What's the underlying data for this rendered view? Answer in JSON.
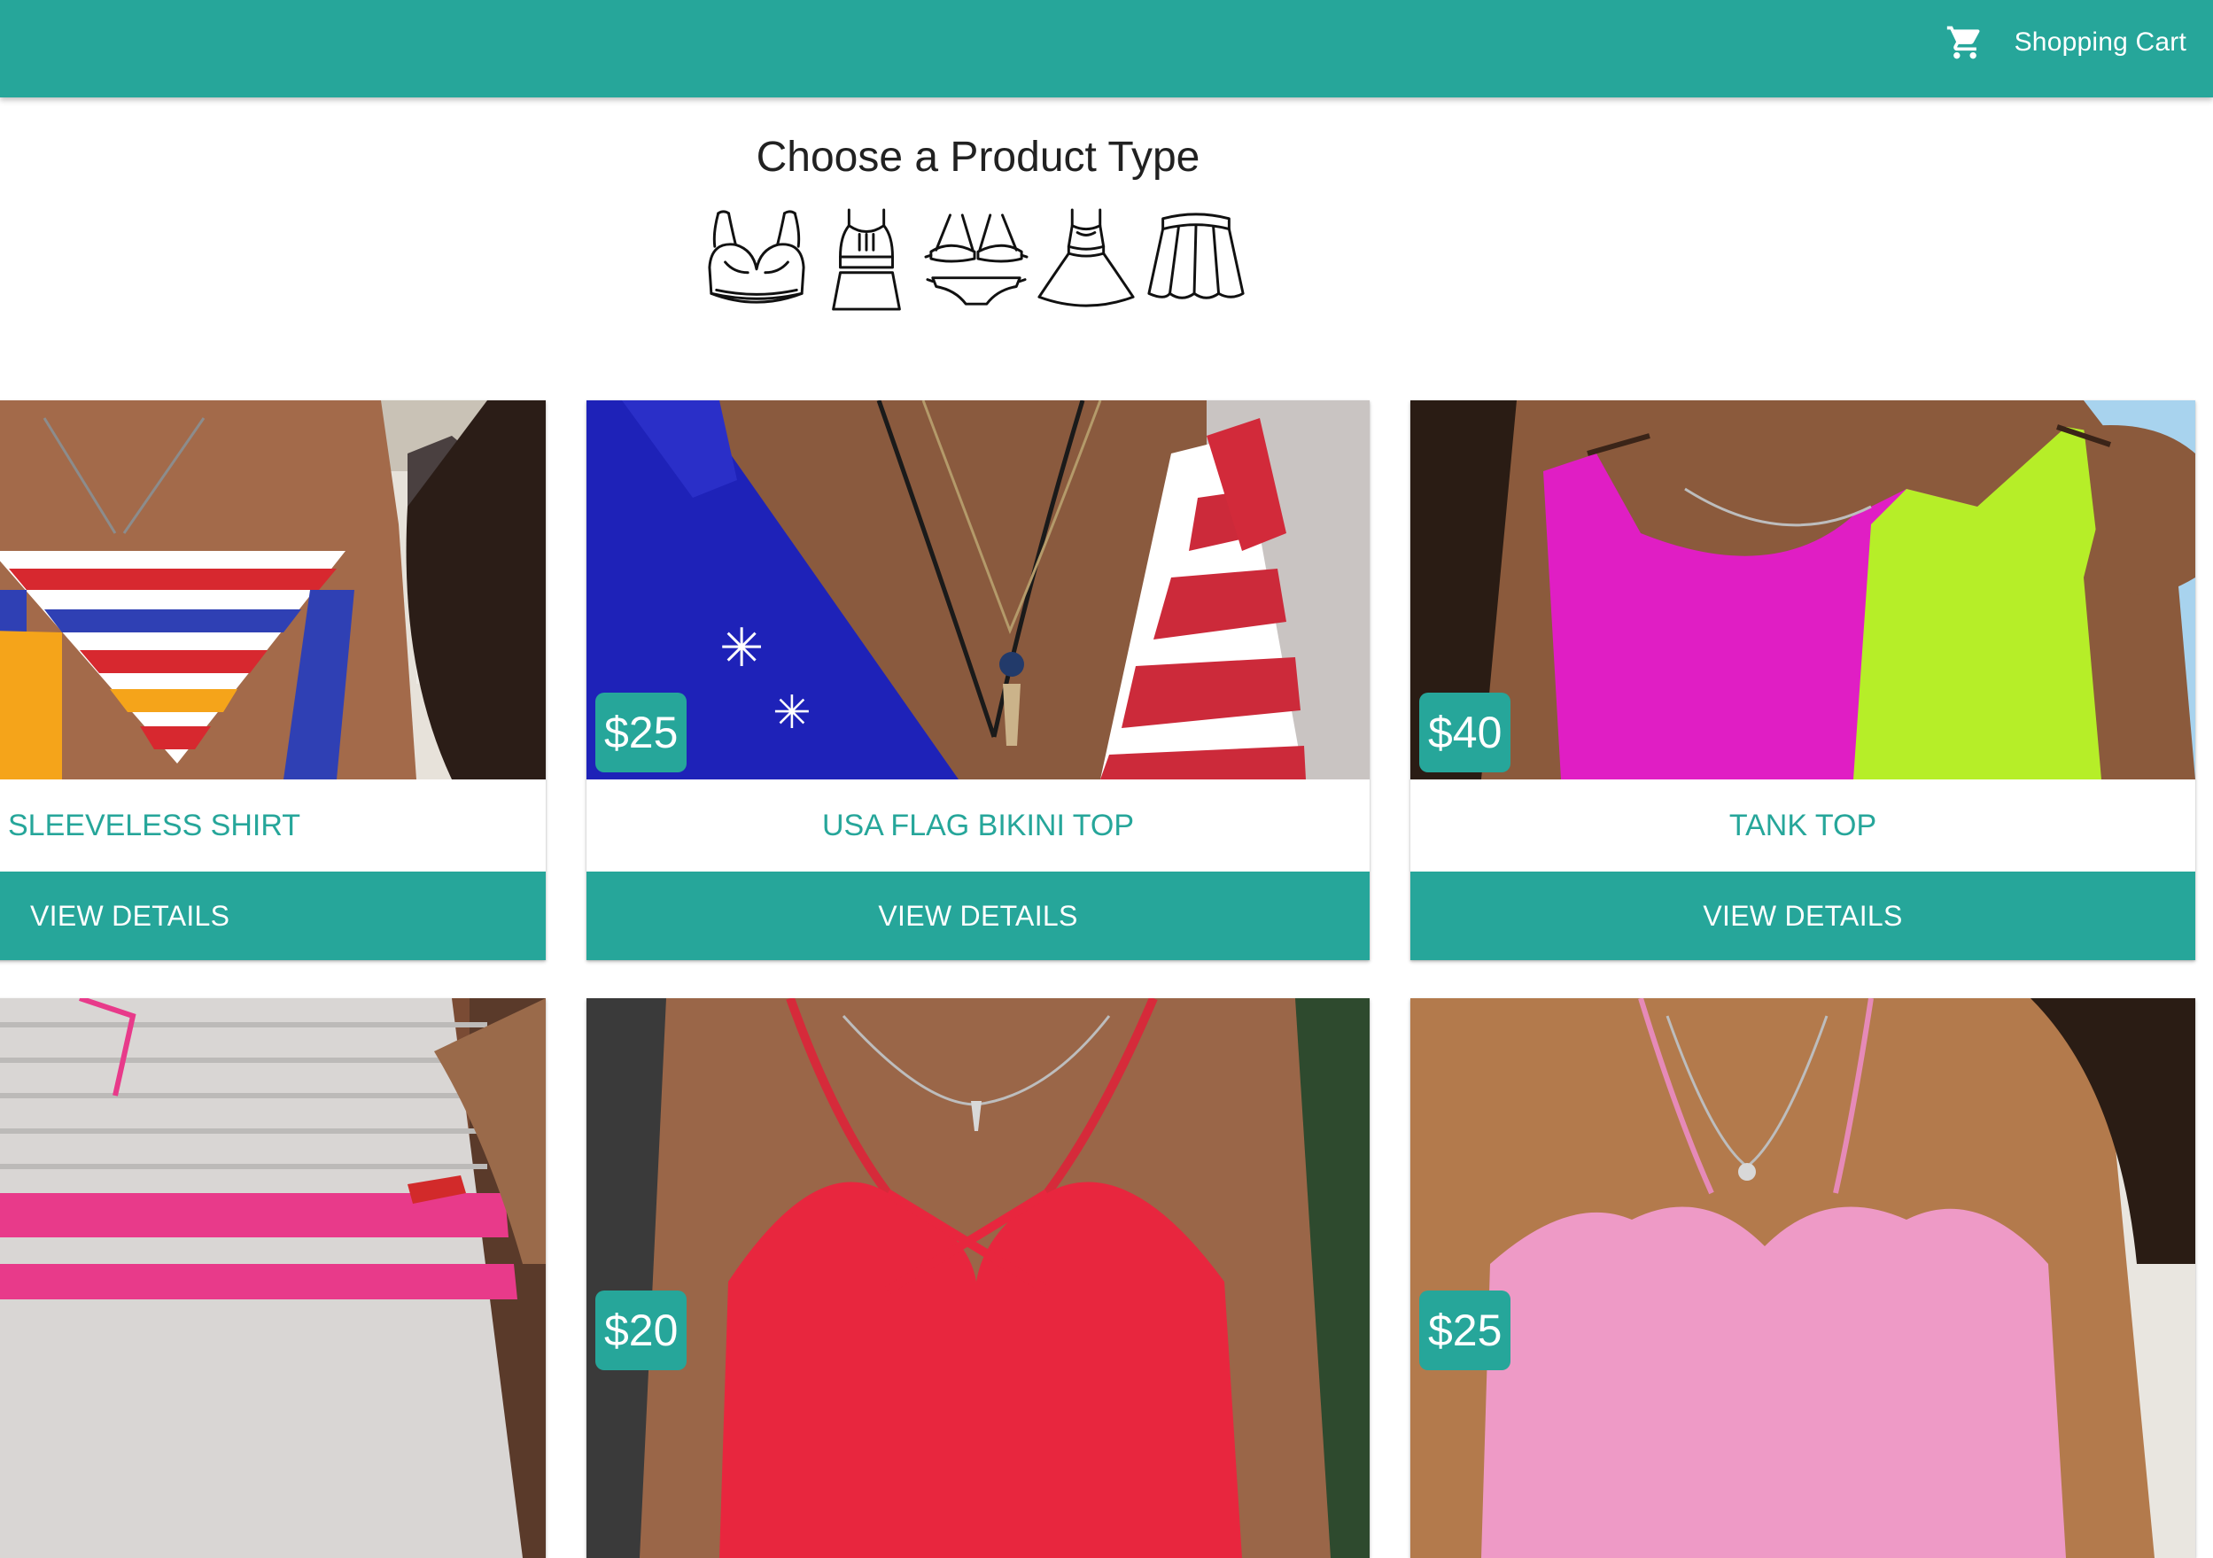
{
  "header": {
    "cart_icon": "shopping-cart-icon",
    "cart_label": "Shopping Cart",
    "accent_color": "#26a69a"
  },
  "product_types": {
    "title": "Choose a Product Type",
    "icons": [
      "bra-icon",
      "crop-top-and-skirt-icon",
      "bikini-icon",
      "dress-icon",
      "skirt-icon"
    ]
  },
  "products": [
    {
      "name": "SLEEVELESS SHIRT",
      "price": "",
      "button": "VIEW DETAILS"
    },
    {
      "name": "USA FLAG BIKINI TOP",
      "price": "$25",
      "button": "VIEW DETAILS"
    },
    {
      "name": "TANK TOP",
      "price": "$40",
      "button": "VIEW DETAILS"
    },
    {
      "name": "",
      "price": "",
      "button": ""
    },
    {
      "name": "",
      "price": "$20",
      "button": ""
    },
    {
      "name": "",
      "price": "$25",
      "button": ""
    }
  ]
}
